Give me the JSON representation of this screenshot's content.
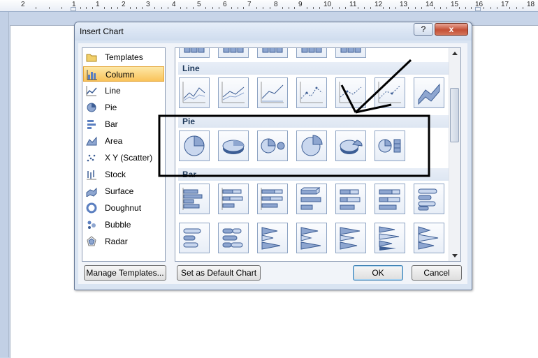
{
  "ruler": {
    "numbers": [
      "2",
      "1",
      "1",
      "2",
      "3",
      "4",
      "5",
      "6",
      "7",
      "8",
      "9",
      "10",
      "11",
      "12",
      "13",
      "14",
      "15",
      "16",
      "17",
      "18"
    ]
  },
  "dialog": {
    "title": "Insert Chart",
    "help_label": "?",
    "close_label": "x",
    "chart_types": [
      {
        "label": "Templates",
        "icon": "folder-icon"
      },
      {
        "label": "Column",
        "icon": "column-chart-icon",
        "selected": true
      },
      {
        "label": "Line",
        "icon": "line-chart-icon"
      },
      {
        "label": "Pie",
        "icon": "pie-chart-icon"
      },
      {
        "label": "Bar",
        "icon": "bar-chart-icon"
      },
      {
        "label": "Area",
        "icon": "area-chart-icon"
      },
      {
        "label": "X Y (Scatter)",
        "icon": "scatter-chart-icon"
      },
      {
        "label": "Stock",
        "icon": "stock-chart-icon"
      },
      {
        "label": "Surface",
        "icon": "surface-chart-icon"
      },
      {
        "label": "Doughnut",
        "icon": "doughnut-chart-icon"
      },
      {
        "label": "Bubble",
        "icon": "bubble-chart-icon"
      },
      {
        "label": "Radar",
        "icon": "radar-chart-icon"
      }
    ],
    "gallery": {
      "sections": [
        {
          "title": "Line"
        },
        {
          "title": "Pie"
        },
        {
          "title": "Bar"
        }
      ]
    },
    "buttons": {
      "manage_templates": "Manage Templates...",
      "set_default": "Set as Default Chart",
      "ok": "OK",
      "cancel": "Cancel"
    }
  },
  "colors": {
    "accent": "#f9c35a",
    "chart_fill": "#8ea6d0",
    "chart_stroke": "#3d5e95"
  }
}
